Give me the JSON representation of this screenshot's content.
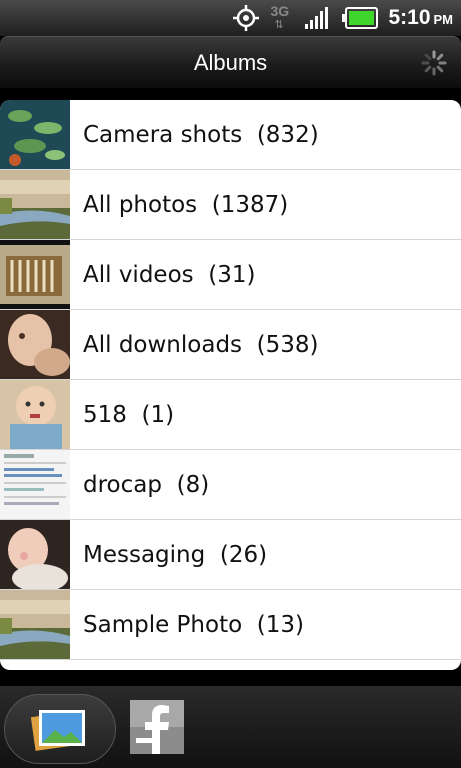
{
  "status_bar": {
    "network": "3G",
    "time": "5:10",
    "ampm": "PM",
    "icons": [
      "gps-icon",
      "network-3g-icon",
      "signal-icon",
      "battery-icon"
    ]
  },
  "header": {
    "title": "Albums"
  },
  "albums": [
    {
      "name": "Camera shots",
      "count": "(832)"
    },
    {
      "name": "All photos",
      "count": "(1387)"
    },
    {
      "name": "All videos",
      "count": "(31)"
    },
    {
      "name": "All downloads",
      "count": "(538)"
    },
    {
      "name": "518",
      "count": "(1)"
    },
    {
      "name": "drocap",
      "count": "(8)"
    },
    {
      "name": "Messaging",
      "count": "(26)"
    },
    {
      "name": "Sample Photo",
      "count": "(13)"
    }
  ],
  "bottom_tabs": [
    {
      "icon": "gallery-icon"
    },
    {
      "icon": "facebook-icon"
    }
  ],
  "colors": {
    "battery": "#3fd62b",
    "list_bg": "#ffffff",
    "text": "#111111"
  }
}
